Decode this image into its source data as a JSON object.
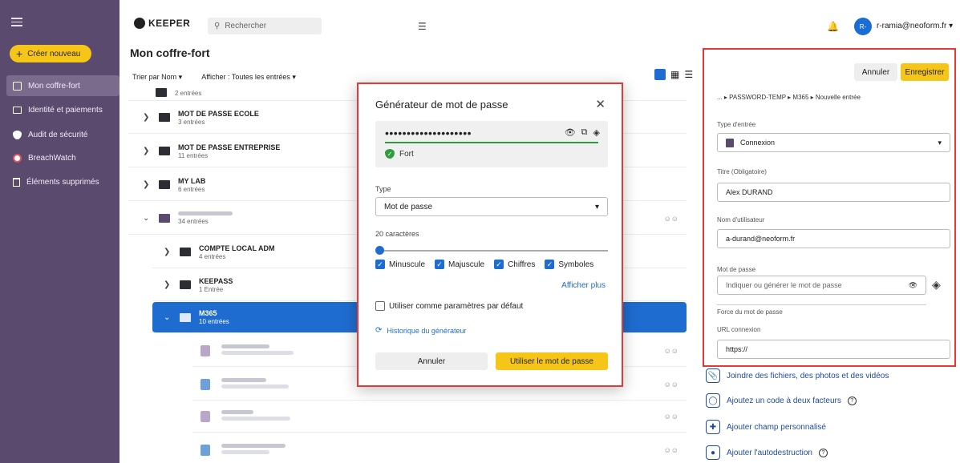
{
  "sidebar": {
    "create_label": "Créer nouveau",
    "items": [
      {
        "label": "Mon coffre-fort",
        "icon": "vault-icon"
      },
      {
        "label": "Identité et paiements",
        "icon": "card-icon"
      },
      {
        "label": "Audit de sécurité",
        "icon": "shield-icon"
      },
      {
        "label": "BreachWatch",
        "icon": "breachwatch-icon"
      },
      {
        "label": "Éléments supprimés",
        "icon": "trash-icon"
      }
    ]
  },
  "header": {
    "logo": "KEEPER",
    "search_placeholder": "Rechercher",
    "user_initials": "R-",
    "user_email": "r-ramia@neoform.fr ▾"
  },
  "vault": {
    "title": "Mon coffre-fort",
    "sort_label": "Trier par Nom ▾",
    "show_label": "Afficher : Toutes les entrées ▾"
  },
  "folders": [
    {
      "title": "",
      "sub": "2 entrées"
    },
    {
      "title": "MOT DE PASSE ECOLE",
      "sub": "3 entrées"
    },
    {
      "title": "MOT DE PASSE ENTREPRISE",
      "sub": "11 entrées"
    },
    {
      "title": "MY LAB",
      "sub": "6 entrées"
    },
    {
      "title": "",
      "sub": "34 entrées"
    },
    {
      "title": "COMPTE LOCAL ADM",
      "sub": "4 entrées"
    },
    {
      "title": "KEEPASS",
      "sub": "1 Entrée"
    },
    {
      "title": "M365",
      "sub": "10 entrées"
    }
  ],
  "generator": {
    "title": "Générateur de mot de passe",
    "password": "••••••••••••••••••••",
    "strength": "Fort",
    "type_label": "Type",
    "type_value": "Mot de passe",
    "length_label": "20 caractères",
    "options": [
      "Minuscule",
      "Majuscule",
      "Chiffres",
      "Symboles"
    ],
    "show_more": "Afficher plus",
    "default_label": "Utiliser comme paramètres par défaut",
    "history_label": "Historique du générateur",
    "cancel_label": "Annuler",
    "use_label": "Utiliser le mot de passe"
  },
  "panel": {
    "cancel_label": "Annuler",
    "save_label": "Enregistrer",
    "breadcrumb": "... ▸ PASSWORD-TEMP ▸ M365 ▸ Nouvelle entrée",
    "entry_type_label": "Type d'entrée",
    "entry_type_value": "Connexion",
    "title_label": "Titre (Obligatoire)",
    "title_value": "Alex DURAND",
    "username_label": "Nom d'utilisateur",
    "username_value": "a-durand@neoform.fr",
    "password_label": "Mot de passe",
    "password_placeholder": "Indiquer ou générer le mot de passe",
    "strength_label": "Force du mot de passe",
    "url_label": "URL connexion",
    "url_value": "https://"
  },
  "actions": [
    {
      "label": "Joindre des fichiers, des photos et des vidéos",
      "icon": "paperclip-icon"
    },
    {
      "label": "Ajoutez un code à deux facteurs",
      "icon": "two-factor-icon"
    },
    {
      "label": "Ajouter champ personnalisé",
      "icon": "custom-field-icon"
    },
    {
      "label": "Ajouter l'autodestruction",
      "icon": "self-destruct-icon"
    }
  ],
  "colors": {
    "sidebar": "#5a4a6e",
    "accent_yellow": "#f5c518",
    "accent_blue": "#1f6cd0",
    "highlight_red": "#e53935",
    "strength_green": "#2f9d3d"
  }
}
